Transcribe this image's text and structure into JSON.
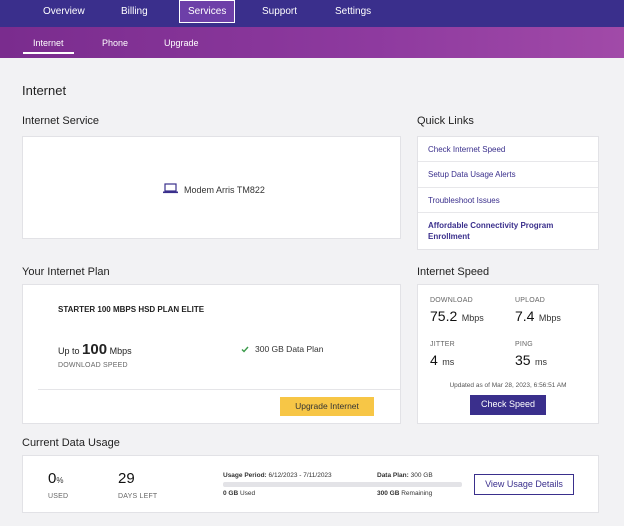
{
  "top_nav": {
    "items": [
      "Overview",
      "Billing",
      "Services",
      "Support",
      "Settings"
    ],
    "active": "Services"
  },
  "sub_nav": {
    "items": [
      "Internet",
      "Phone",
      "Upgrade"
    ],
    "active": "Internet"
  },
  "page_title": "Internet",
  "internet_service": {
    "heading": "Internet Service",
    "device_icon": "laptop-icon",
    "device_label": "Modem Arris TM822"
  },
  "quick_links": {
    "heading": "Quick Links",
    "items": [
      "Check Internet Speed",
      "Setup Data Usage Alerts",
      "Troubleshoot Issues",
      "Affordable Connectivity Program Enrollment"
    ]
  },
  "plan": {
    "heading": "Your Internet Plan",
    "name": "STARTER 100 MBPS HSD PLAN ELITE",
    "up_to": "Up to",
    "speed_value": "100",
    "speed_unit": "Mbps",
    "speed_caption": "DOWNLOAD SPEED",
    "feature_icon": "check-icon",
    "feature": "300 GB Data Plan",
    "upgrade_label": "Upgrade Internet"
  },
  "speed": {
    "heading": "Internet Speed",
    "download_label": "DOWNLOAD",
    "download_value": "75.2",
    "download_unit": "Mbps",
    "upload_label": "UPLOAD",
    "upload_value": "7.4",
    "upload_unit": "Mbps",
    "jitter_label": "JITTER",
    "jitter_value": "4",
    "jitter_unit": "ms",
    "ping_label": "PING",
    "ping_value": "35",
    "ping_unit": "ms",
    "updated": "Updated as of Mar 28, 2023, 6:56:51 AM",
    "button_label": "Check Speed"
  },
  "usage": {
    "heading": "Current Data Usage",
    "percent_value": "0",
    "percent_unit": "%",
    "percent_caption": "USED",
    "days_value": "29",
    "days_caption": "DAYS LEFT",
    "period_label": "Usage Period:",
    "period_value": "6/12/2023 - 7/11/2023",
    "plan_label": "Data Plan:",
    "plan_value": "300 GB",
    "used_fraction": 0,
    "used_value": "0 GB",
    "used_label": "Used",
    "remaining_value": "300 GB",
    "remaining_label": "Remaining",
    "button_label": "View Usage Details"
  }
}
